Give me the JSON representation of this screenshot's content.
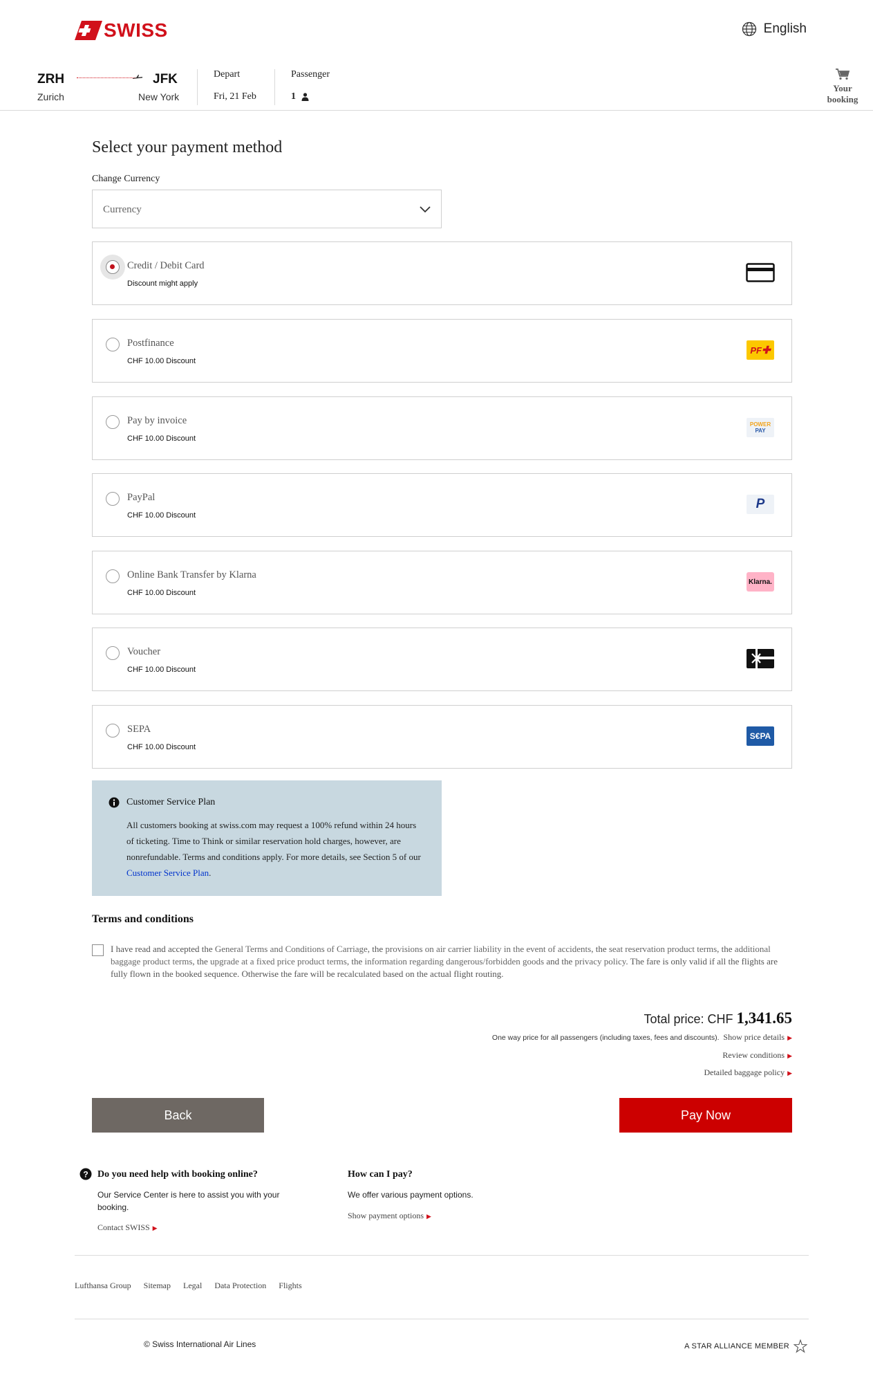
{
  "header": {
    "logo_text": "SWISS",
    "language": "English"
  },
  "flight": {
    "origin_code": "ZRH",
    "origin_city": "Zurich",
    "dest_code": "JFK",
    "dest_city": "New York",
    "depart_label": "Depart",
    "depart_value": "Fri, 21 Feb",
    "passenger_label": "Passenger",
    "passenger_value": "1",
    "cart_label_1": "Your",
    "cart_label_2": "booking"
  },
  "main": {
    "title": "Select your payment method",
    "currency_label": "Change Currency",
    "currency_placeholder": "Currency"
  },
  "payment_methods": [
    {
      "name": "Credit / Debit Card",
      "sub": "Discount might apply",
      "selected": true,
      "icon": "credit-card-icon"
    },
    {
      "name": "Postfinance",
      "sub": "CHF 10.00 Discount",
      "selected": false,
      "icon": "postfinance-logo"
    },
    {
      "name": "Pay by invoice",
      "sub": "CHF 10.00 Discount",
      "selected": false,
      "icon": "powerpay-logo"
    },
    {
      "name": "PayPal",
      "sub": "CHF 10.00 Discount",
      "selected": false,
      "icon": "paypal-logo"
    },
    {
      "name": "Online Bank Transfer by Klarna",
      "sub": "CHF 10.00 Discount",
      "selected": false,
      "icon": "klarna-logo"
    },
    {
      "name": "Voucher",
      "sub": "CHF 10.00 Discount",
      "selected": false,
      "icon": "voucher-icon"
    },
    {
      "name": "SEPA",
      "sub": "CHF 10.00 Discount",
      "selected": false,
      "icon": "sepa-logo"
    }
  ],
  "logo_texts": {
    "postfinance": "PF",
    "powerpay_1": "POWER",
    "powerpay_2": "PAY",
    "paypal": "P",
    "klarna": "Klarna.",
    "sepa": "S€PA"
  },
  "info_box": {
    "title": "Customer Service Plan",
    "body": "All customers booking at swiss.com may request a 100% refund within 24 hours of ticketing. Time to Think or similar reservation hold charges, however, are nonrefundable. Terms and conditions apply. For more details, see Section 5 of our ",
    "link": "Customer Service Plan",
    "end": "."
  },
  "terms": {
    "title": "Terms and conditions",
    "t1": "I have read and accepted the ",
    "l1": "General Terms and Conditions of Carriage",
    "t2": ", the ",
    "l2": "provisions on air carrier liability in the event of accidents",
    "t3": ", the ",
    "l3": "seat reservation product terms",
    "t4": ", the ",
    "l4": "additional baggage product terms",
    "t5": ", the ",
    "l5": "upgrade at a fixed price product terms",
    "t6": ", the ",
    "l6": "information regarding dangerous/forbidden goods",
    "t7": " and the ",
    "l7": "privacy policy",
    "t8": ". The fare is only valid if all the flights are fully flown in the booked sequence. Otherwise the fare will be recalculated based on the actual flight routing."
  },
  "price": {
    "label": "Total price: CHF ",
    "amount": "1,341.65",
    "note": "One way price for all passengers (including taxes, fees and discounts).",
    "details_link": "Show price details",
    "review_link": "Review conditions",
    "baggage_link": "Detailed baggage policy"
  },
  "buttons": {
    "back": "Back",
    "pay": "Pay Now"
  },
  "help": {
    "left_title": "Do you need help with booking online?",
    "left_body": "Our Service Center is here to assist you with your booking.",
    "left_link": "Contact SWISS",
    "right_title": "How can I pay?",
    "right_body": "We offer various payment options.",
    "right_link": "Show payment options"
  },
  "footer": {
    "links": [
      "Lufthansa Group",
      "Sitemap",
      "Legal",
      "Data Protection",
      "Flights"
    ],
    "copyright": "© Swiss International Air Lines",
    "alliance": "A STAR ALLIANCE MEMBER"
  },
  "colors": {
    "brand_red": "#d1111b",
    "pay_button": "#cc0000",
    "back_button": "#6e6863",
    "info_bg": "#c8d8e0"
  }
}
